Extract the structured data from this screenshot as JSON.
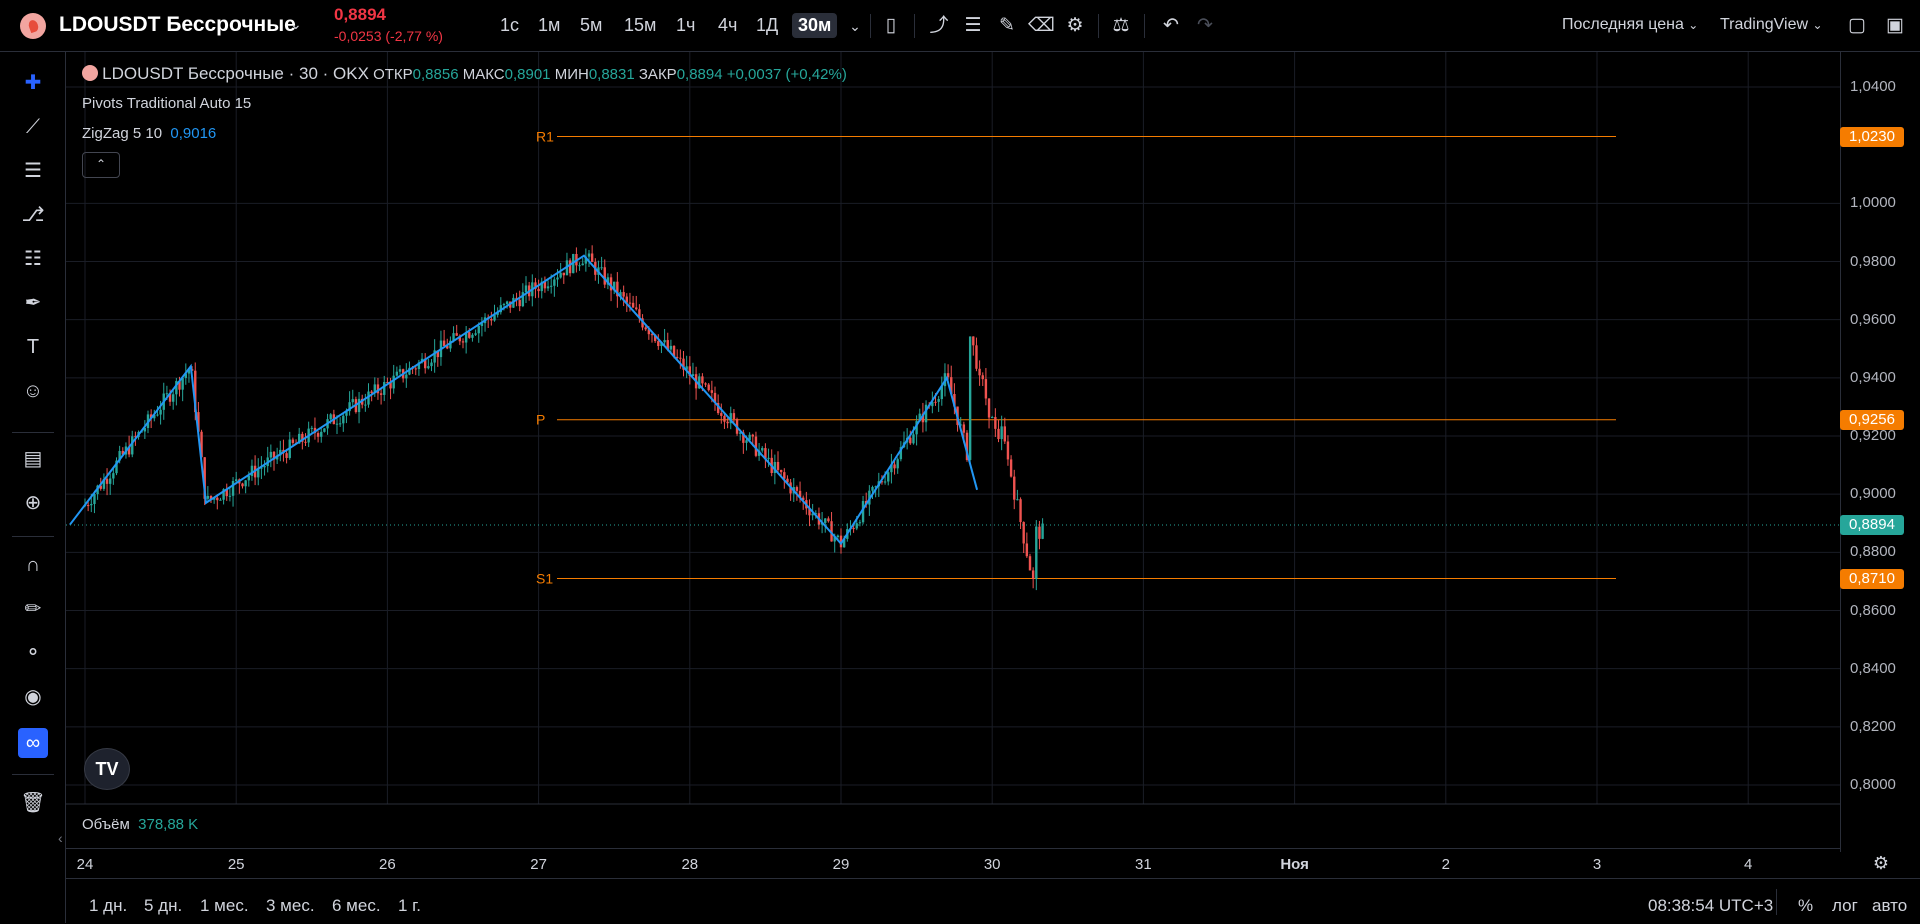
{
  "header": {
    "symbol": "LDOUSDT Бессрочные",
    "price": "0,8894",
    "change": "-0,0253 (-2,77 %)",
    "timeframes": [
      "1с",
      "1м",
      "5м",
      "15м",
      "1ч",
      "4ч",
      "1Д",
      "30м"
    ],
    "price_type": "Последняя цена",
    "provider": "TradingView",
    "icons": [
      "bar-style-icon",
      "indicators-icon",
      "templates-icon",
      "alert-icon",
      "replay-icon",
      "settings-icon",
      "compare-icon",
      "undo-icon",
      "redo-icon",
      "fullscreen-icon"
    ]
  },
  "legend": {
    "title": "LDOUSDT Бессрочные · 30 · OKX",
    "ohlc": [
      {
        "k": "ОТКР",
        "v": "0,8856"
      },
      {
        "k": "МАКС",
        "v": "0,8901"
      },
      {
        "k": "МИН",
        "v": "0,8831"
      },
      {
        "k": "ЗАКР",
        "v": "0,8894"
      }
    ],
    "delta": "+0,0037 (+0,42%)",
    "indicator1": "Pivots Traditional Auto 15",
    "indicator2_name": "ZigZag 5 10",
    "indicator2_value": "0,9016"
  },
  "pivots": {
    "r1": {
      "label": "R1",
      "value": "1,0230"
    },
    "p": {
      "label": "P",
      "value": "0,9256"
    },
    "s1": {
      "label": "S1",
      "value": "0,8710"
    }
  },
  "last_price_label": "0,8894",
  "y_ticks": [
    "1,0400",
    "1,0000",
    "0,9800",
    "0,9600",
    "0,9400",
    "0,9200",
    "0,9000",
    "0,8800",
    "0,8600",
    "0,8400",
    "0,8200",
    "0,8000"
  ],
  "x_ticks": [
    "24",
    "25",
    "26",
    "27",
    "28",
    "29",
    "30",
    "31",
    "Ноя",
    "2",
    "3",
    "4"
  ],
  "volume": {
    "label": "Объём",
    "value": "378,88 K"
  },
  "bottom": {
    "ranges": [
      "1 дн.",
      "5 дн.",
      "1 мес.",
      "3 мес.",
      "6 мес.",
      "1 г."
    ],
    "clock": "08:38:54 UTC+3",
    "percent": "%",
    "log": "лог",
    "auto": "авто"
  },
  "colors": {
    "up": "#26a69a",
    "down": "#ef5350",
    "zigzag": "#2196f3",
    "pivot": "#f57c00",
    "badge": "#f57c00",
    "last": "#26a69a"
  },
  "chart_data": {
    "type": "candlestick",
    "timeframe": "30m",
    "zigzag_points": [
      {
        "x": "23.9",
        "y": 0.8895
      },
      {
        "x": "24.7",
        "y": 0.944
      },
      {
        "x": "24.8",
        "y": 0.897
      },
      {
        "x": "27.3",
        "y": 0.982
      },
      {
        "x": "29.0",
        "y": 0.883
      },
      {
        "x": "29.7",
        "y": 0.94
      },
      {
        "x": "29.9",
        "y": 0.9015
      }
    ],
    "pivot_levels": {
      "R1": 1.023,
      "P": 0.9256,
      "S1": 0.871
    },
    "ylim": [
      0.795,
      1.048
    ]
  }
}
